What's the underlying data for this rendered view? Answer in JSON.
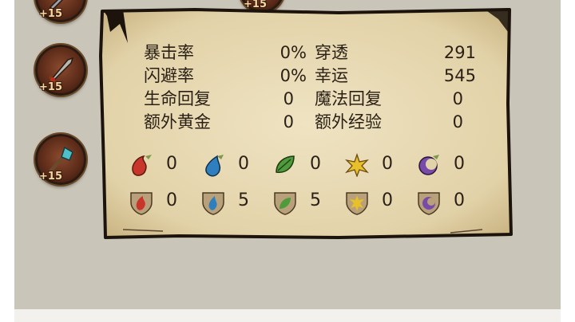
{
  "equipment_slots": [
    {
      "name": "slot-1",
      "level": "+15",
      "weapon": "weapon-top"
    },
    {
      "name": "slot-2",
      "level": "+15",
      "weapon": "sword-icon"
    },
    {
      "name": "slot-3",
      "level": "+15",
      "weapon": "staff-icon"
    }
  ],
  "stats": {
    "crit_rate": {
      "label": "暴击率",
      "value": "0%"
    },
    "dodge_rate": {
      "label": "闪避率",
      "value": "0%"
    },
    "hp_regen": {
      "label": "生命回复",
      "value": "0"
    },
    "extra_gold": {
      "label": "额外黄金",
      "value": "0"
    },
    "penetration": {
      "label": "穿透",
      "value": "291"
    },
    "luck": {
      "label": "幸运",
      "value": "545"
    },
    "mana_regen": {
      "label": "魔法回复",
      "value": "0"
    },
    "extra_exp": {
      "label": "额外经验",
      "value": "0"
    }
  },
  "elements": {
    "attack": [
      {
        "type": "fire",
        "icon": "fire-attack-icon",
        "value": "0",
        "color": "#c8352a"
      },
      {
        "type": "water",
        "icon": "water-attack-icon",
        "value": "0",
        "color": "#2f7fbf"
      },
      {
        "type": "nature",
        "icon": "leaf-attack-icon",
        "value": "0",
        "color": "#4f9a3a"
      },
      {
        "type": "light",
        "icon": "light-attack-icon",
        "value": "0",
        "color": "#e8c02a"
      },
      {
        "type": "dark",
        "icon": "dark-attack-icon",
        "value": "0",
        "color": "#7a4aa8"
      }
    ],
    "defense": [
      {
        "type": "fire",
        "icon": "fire-defense-icon",
        "value": "0",
        "color": "#c8352a"
      },
      {
        "type": "water",
        "icon": "water-defense-icon",
        "value": "5",
        "color": "#2f7fbf"
      },
      {
        "type": "nature",
        "icon": "leaf-defense-icon",
        "value": "5",
        "color": "#4f9a3a"
      },
      {
        "type": "light",
        "icon": "light-defense-icon",
        "value": "0",
        "color": "#e8c02a"
      },
      {
        "type": "dark",
        "icon": "dark-defense-icon",
        "value": "0",
        "color": "#7a4aa8"
      }
    ]
  }
}
